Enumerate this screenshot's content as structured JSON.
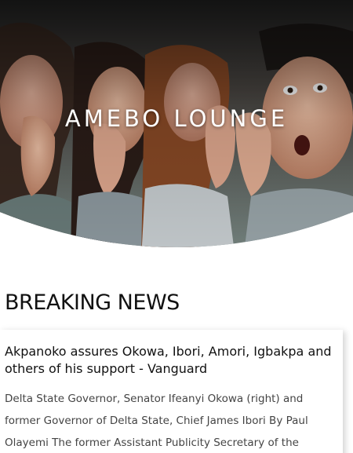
{
  "hero": {
    "title": "AMEBO LOUNGE",
    "image_description": "people-whispering"
  },
  "section": {
    "heading": "BREAKING NEWS"
  },
  "article": {
    "title": "Akpanoko assures Okowa, Ibori, Amori, Igbakpa and others of his support - Vanguard",
    "excerpt": "Delta State Governor, Senator Ifeanyi Okowa (right) and former Governor of Delta State, Chief James Ibori By Paul Olayemi The former Assistant Publicity Secretary of the"
  },
  "colors": {
    "text_dark": "#111111",
    "text_body": "#444444",
    "background": "#ffffff"
  }
}
